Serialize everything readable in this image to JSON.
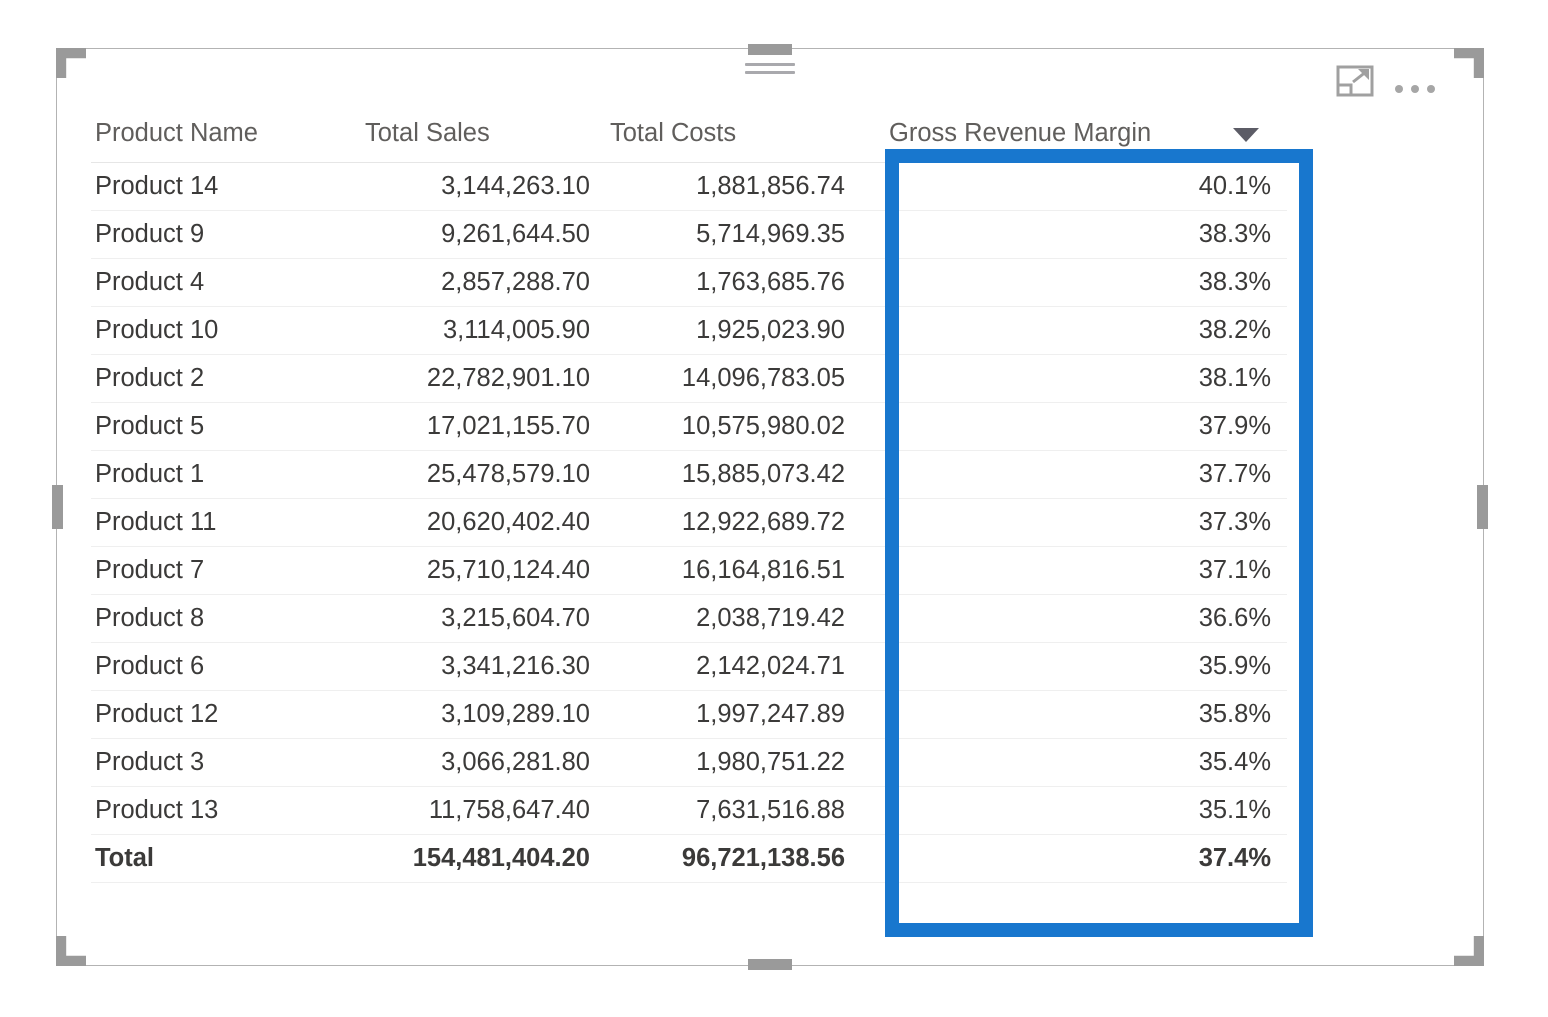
{
  "visual": {
    "type": "table",
    "drag_handle_name": "drag-handle",
    "focus_mode_label": "Focus mode",
    "more_options_label": "More options",
    "selected": true,
    "highlight_color": "#1877CE",
    "highlighted_column": "Gross Revenue Margin"
  },
  "table": {
    "columns": [
      {
        "key": "product_name",
        "label": "Product Name",
        "align": "left"
      },
      {
        "key": "total_sales",
        "label": "Total Sales",
        "align": "right"
      },
      {
        "key": "total_costs",
        "label": "Total Costs",
        "align": "right"
      },
      {
        "key": "gross_revenue_margin",
        "label": "Gross Revenue Margin",
        "align": "right",
        "sorted": "descending",
        "sort_icon": "sort-descending-icon"
      }
    ],
    "rows": [
      {
        "product_name": "Product 14",
        "total_sales": "3,144,263.10",
        "total_costs": "1,881,856.74",
        "gross_revenue_margin": "40.1%"
      },
      {
        "product_name": "Product 9",
        "total_sales": "9,261,644.50",
        "total_costs": "5,714,969.35",
        "gross_revenue_margin": "38.3%"
      },
      {
        "product_name": "Product 4",
        "total_sales": "2,857,288.70",
        "total_costs": "1,763,685.76",
        "gross_revenue_margin": "38.3%"
      },
      {
        "product_name": "Product 10",
        "total_sales": "3,114,005.90",
        "total_costs": "1,925,023.90",
        "gross_revenue_margin": "38.2%"
      },
      {
        "product_name": "Product 2",
        "total_sales": "22,782,901.10",
        "total_costs": "14,096,783.05",
        "gross_revenue_margin": "38.1%"
      },
      {
        "product_name": "Product 5",
        "total_sales": "17,021,155.70",
        "total_costs": "10,575,980.02",
        "gross_revenue_margin": "37.9%"
      },
      {
        "product_name": "Product 1",
        "total_sales": "25,478,579.10",
        "total_costs": "15,885,073.42",
        "gross_revenue_margin": "37.7%"
      },
      {
        "product_name": "Product 11",
        "total_sales": "20,620,402.40",
        "total_costs": "12,922,689.72",
        "gross_revenue_margin": "37.3%"
      },
      {
        "product_name": "Product 7",
        "total_sales": "25,710,124.40",
        "total_costs": "16,164,816.51",
        "gross_revenue_margin": "37.1%"
      },
      {
        "product_name": "Product 8",
        "total_sales": "3,215,604.70",
        "total_costs": "2,038,719.42",
        "gross_revenue_margin": "36.6%"
      },
      {
        "product_name": "Product 6",
        "total_sales": "3,341,216.30",
        "total_costs": "2,142,024.71",
        "gross_revenue_margin": "35.9%"
      },
      {
        "product_name": "Product 12",
        "total_sales": "3,109,289.10",
        "total_costs": "1,997,247.89",
        "gross_revenue_margin": "35.8%"
      },
      {
        "product_name": "Product 3",
        "total_sales": "3,066,281.80",
        "total_costs": "1,980,751.22",
        "gross_revenue_margin": "35.4%"
      },
      {
        "product_name": "Product 13",
        "total_sales": "11,758,647.40",
        "total_costs": "7,631,516.88",
        "gross_revenue_margin": "35.1%"
      }
    ],
    "total_row": {
      "product_name": "Total",
      "total_sales": "154,481,404.20",
      "total_costs": "96,721,138.56",
      "gross_revenue_margin": "37.4%"
    }
  },
  "chart_data": {
    "type": "table",
    "title": "",
    "columns": [
      "Product Name",
      "Total Sales",
      "Total Costs",
      "Gross Revenue Margin"
    ],
    "sorted_by": "Gross Revenue Margin",
    "sort_order": "descending",
    "categories": [
      "Product 14",
      "Product 9",
      "Product 4",
      "Product 10",
      "Product 2",
      "Product 5",
      "Product 1",
      "Product 11",
      "Product 7",
      "Product 8",
      "Product 6",
      "Product 12",
      "Product 3",
      "Product 13"
    ],
    "series": [
      {
        "name": "Total Sales",
        "values": [
          3144263.1,
          9261644.5,
          2857288.7,
          3114005.9,
          22782901.1,
          17021155.7,
          25478579.1,
          20620402.4,
          25710124.4,
          3215604.7,
          3341216.3,
          3109289.1,
          3066281.8,
          11758647.4
        ],
        "total": 154481404.2
      },
      {
        "name": "Total Costs",
        "values": [
          1881856.74,
          5714969.35,
          1763685.76,
          1925023.9,
          14096783.05,
          10575980.02,
          15885073.42,
          12922689.72,
          16164816.51,
          2038719.42,
          2142024.71,
          1997247.89,
          1980751.22,
          7631516.88
        ],
        "total": 96721138.56
      },
      {
        "name": "Gross Revenue Margin",
        "values": [
          40.1,
          38.3,
          38.3,
          38.2,
          38.1,
          37.9,
          37.7,
          37.3,
          37.1,
          36.6,
          35.9,
          35.8,
          35.4,
          35.1
        ],
        "unit": "%",
        "total": 37.4
      }
    ]
  }
}
